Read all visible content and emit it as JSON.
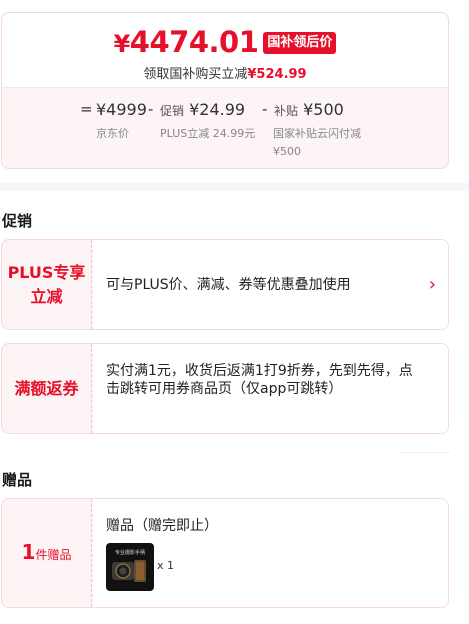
{
  "price": {
    "final_symbol": "¥",
    "final_value": "4474.01",
    "subsidy_tag": "国补领后价",
    "save_text": "领取国补购买立减",
    "save_amount": "¥524.99",
    "formula": {
      "equals": "=",
      "base_value": "¥4999",
      "base_note": "京东价",
      "minus1": "-",
      "promo_prefix": "促销",
      "promo_value": "¥24.99",
      "promo_note": "PLUS立减 24.99元",
      "minus2": "-",
      "subsidy_prefix": "补贴",
      "subsidy_value": "¥500",
      "subsidy_note_line1": "国家补贴云闪付减",
      "subsidy_note_line2": "¥500"
    }
  },
  "promotions": {
    "title": "促销",
    "items": [
      {
        "tag_line1": "PLUS专享",
        "tag_line2": "立减",
        "text": "可与PLUS价、满减、券等优惠叠加使用",
        "chevron": "›"
      },
      {
        "tag_line1": "满额返券",
        "tag_line2": "",
        "text": "实付满1元，收货后返满1打9折券，先到先得，点击跳转可用券商品页（仅app可跳转）"
      }
    ]
  },
  "gifts": {
    "title": "赠品",
    "count_num": "1",
    "count_label": "件赠品",
    "item_title": "赠品（赠完即止）",
    "thumb_caption": "专业摄影手柄",
    "quantity": "x 1"
  },
  "colors": {
    "accent": "#e7102b",
    "tint": "#fdf4f5",
    "border": "#f6d9dd"
  }
}
